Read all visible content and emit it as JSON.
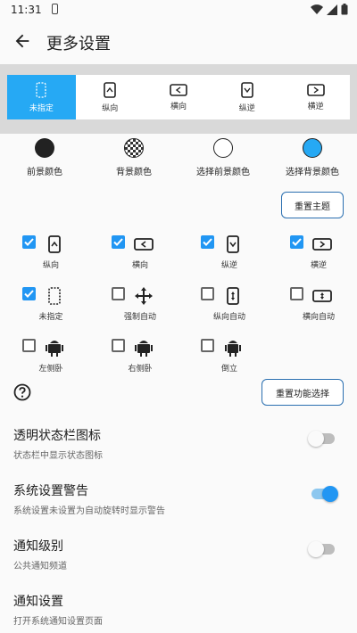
{
  "status_bar": {
    "time": "11:31"
  },
  "app_bar": {
    "title": "更多设置"
  },
  "orientation_modes": [
    {
      "label": "未指定",
      "icon": "unspecified-icon",
      "selected": true
    },
    {
      "label": "纵向",
      "icon": "portrait-icon",
      "selected": false
    },
    {
      "label": "横向",
      "icon": "landscape-icon",
      "selected": false
    },
    {
      "label": "纵逆",
      "icon": "reverse-portrait-icon",
      "selected": false
    },
    {
      "label": "横逆",
      "icon": "reverse-landscape-icon",
      "selected": false
    }
  ],
  "colors": [
    {
      "label": "前景颜色",
      "color": "#222222"
    },
    {
      "label": "背景颜色",
      "color": "checker"
    },
    {
      "label": "选择前景颜色",
      "color": "#ffffff"
    },
    {
      "label": "选择背景颜色",
      "color": "#26a9f4"
    }
  ],
  "reset_theme_label": "重置主题",
  "function_options": [
    {
      "label": "纵向",
      "icon": "portrait-icon",
      "checked": true
    },
    {
      "label": "横向",
      "icon": "landscape-icon",
      "checked": true
    },
    {
      "label": "纵逆",
      "icon": "reverse-portrait-icon",
      "checked": true
    },
    {
      "label": "横逆",
      "icon": "reverse-landscape-icon",
      "checked": true
    },
    {
      "label": "未指定",
      "icon": "unspecified-icon",
      "checked": true
    },
    {
      "label": "强制自动",
      "icon": "force-auto-icon",
      "checked": false
    },
    {
      "label": "纵向自动",
      "icon": "portrait-auto-icon",
      "checked": false
    },
    {
      "label": "横向自动",
      "icon": "landscape-auto-icon",
      "checked": false
    },
    {
      "label": "左侧卧",
      "icon": "lie-left-icon",
      "checked": false
    },
    {
      "label": "右侧卧",
      "icon": "lie-right-icon",
      "checked": false
    },
    {
      "label": "倒立",
      "icon": "upside-down-icon",
      "checked": false
    }
  ],
  "reset_function_label": "重置功能选择",
  "settings": [
    {
      "title": "透明状态栏图标",
      "subtitle": "状态栏中显示状态图标",
      "toggle": false
    },
    {
      "title": "系统设置警告",
      "subtitle": "系统设置未设置为自动旋转时显示警告",
      "toggle": true
    },
    {
      "title": "通知级别",
      "subtitle": "公共通知频道",
      "toggle": false
    },
    {
      "title": "通知设置",
      "subtitle": "打开系统通知设置页面"
    }
  ],
  "accent_color": "#2196f3"
}
